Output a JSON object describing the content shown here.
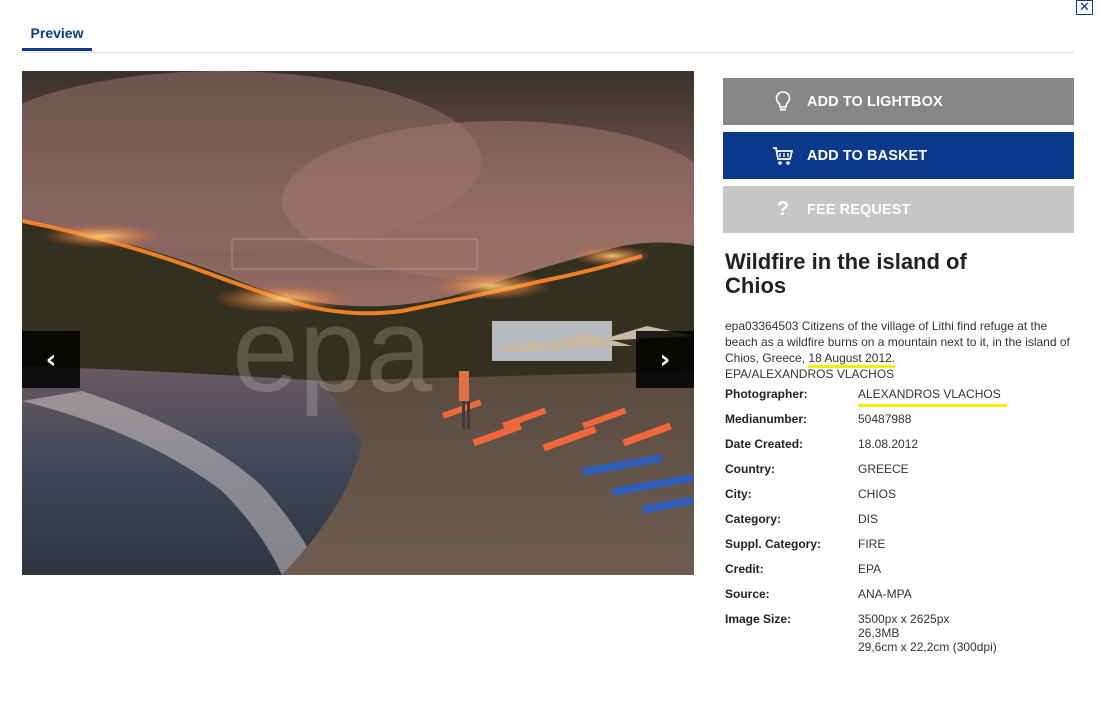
{
  "tabs": [
    {
      "label": "Preview",
      "active": true
    }
  ],
  "close_icon": "close-icon",
  "actions": {
    "lightbox": {
      "label": "ADD TO LIGHTBOX",
      "icon": "lightbulb-icon"
    },
    "basket": {
      "label": "ADD TO BASKET",
      "icon": "cart-icon"
    },
    "fee": {
      "label": "FEE REQUEST",
      "icon": "question-icon",
      "glyph": "?"
    }
  },
  "image": {
    "watermark": "epa",
    "prev_glyph": "‹",
    "next_glyph": "›"
  },
  "title": "Wildfire in the island of Chios",
  "caption": {
    "main": "epa03364503 Citizens of the village of Lithi find refuge at the beach as a wildfire burns on a mountain next to it, in the island of Chios, Greece,",
    "date": "18 August 2012.",
    "credit": "EPA/ALEXANDROS VLACHOS"
  },
  "meta": {
    "photographer": {
      "label": "Photographer:",
      "value": "ALEXANDROS VLACHOS"
    },
    "medianumber": {
      "label": "Medianumber:",
      "value": "50487988"
    },
    "date_created": {
      "label": "Date Created:",
      "value": "18.08.2012"
    },
    "country": {
      "label": "Country:",
      "value": "GREECE"
    },
    "city": {
      "label": "City:",
      "value": "CHIOS"
    },
    "category": {
      "label": "Category:",
      "value": "DIS"
    },
    "suppl_category": {
      "label": "Suppl. Category:",
      "value": "FIRE"
    },
    "credit": {
      "label": "Credit:",
      "value": "EPA"
    },
    "source": {
      "label": "Source:",
      "value": "ANA-MPA"
    },
    "image_size": {
      "label": "Image Size:",
      "pixels": "3500px x 2625px",
      "filesize": "26,3MB",
      "print": "29,6cm x 22,2cm (300dpi)"
    }
  },
  "colors": {
    "brand": "#0b3a8c",
    "highlight": "#f4f000",
    "lightbox_btn": "#878787",
    "fee_btn": "#c6c6c6"
  }
}
